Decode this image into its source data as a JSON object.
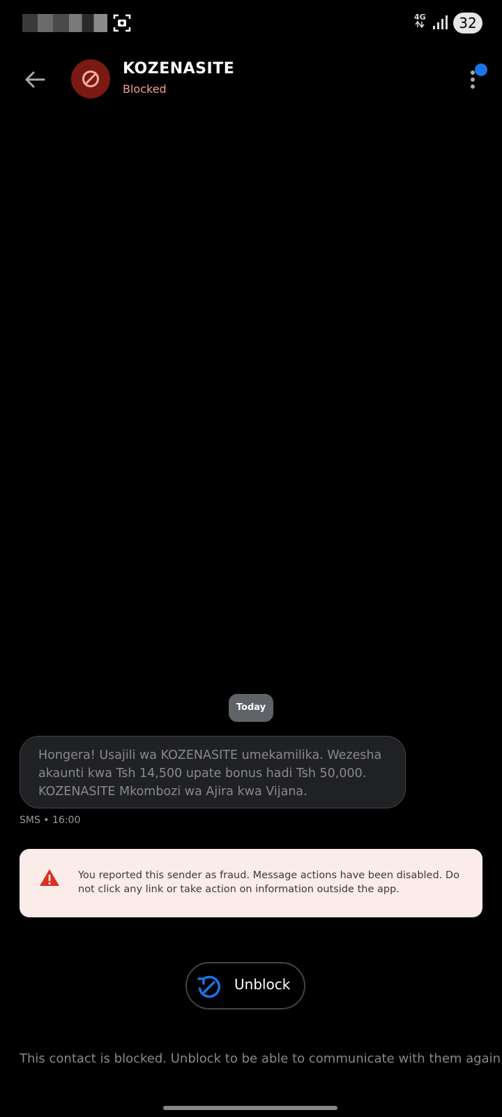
{
  "status_bar": {
    "network_label": "4G",
    "battery_level": "32",
    "icons": [
      "screenshot-icon",
      "data-arrows-icon",
      "signal-icon",
      "battery-icon"
    ]
  },
  "header": {
    "contact_name": "KOZENASITE",
    "contact_status": "Blocked",
    "icons": [
      "back-arrow-icon",
      "blocked-avatar-icon",
      "more-vert-icon"
    ],
    "colors": {
      "avatar_bg": "#7a1a12",
      "status_text": "#f0a090",
      "notification_dot": "#1a73e8"
    }
  },
  "conversation": {
    "date_label": "Today",
    "message": {
      "text": "Hongera! Usajili wa KOZENASITE umekamilika. Wezesha akaunti kwa Tsh 14,500 upate bonus hadi Tsh 50,000. KOZENASITE Mkombozi wa Ajira kwa Vijana.",
      "meta": "SMS • 16:00"
    }
  },
  "fraud_banner": {
    "text": "You reported this sender as fraud. Message actions have been disabled. Do not click any link or take action on information outside the app.",
    "icon": "warning-icon",
    "colors": {
      "background": "#fcece9",
      "icon": "#d93025"
    }
  },
  "actions": {
    "unblock_label": "Unblock",
    "icon": "unblock-icon",
    "icon_color": "#1a73e8"
  },
  "footer": {
    "text": "This contact is blocked. Unblock to be able to communicate with them again."
  }
}
